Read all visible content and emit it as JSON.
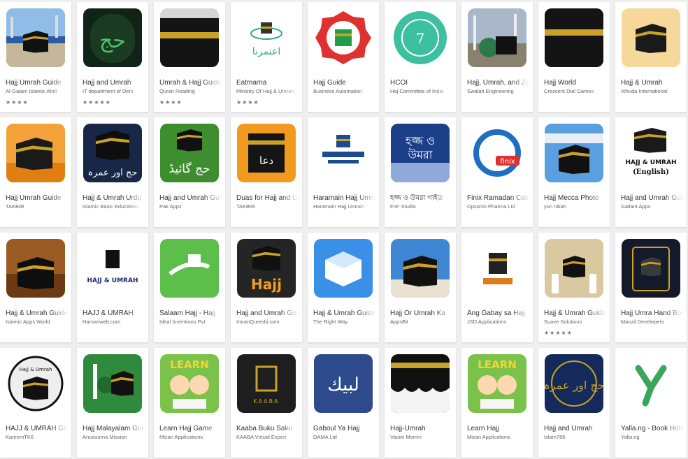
{
  "apps": [
    {
      "title": "Hajj Umrah Guide",
      "developer": "Al-Galam Islamic Ahdi",
      "stars": "★★★★",
      "icon": "kaaba-photo-icon",
      "colors": [
        "#5b8fd0",
        "#1d2a3a"
      ]
    },
    {
      "title": "Hajj and Umrah",
      "developer": "IT department of Deni",
      "stars": "★★★★★",
      "icon": "hajj-umrah-calligraphy-icon",
      "colors": [
        "#0d1f14",
        "#3fae5a"
      ]
    },
    {
      "title": "Umrah & Hajj Guide",
      "developer": "Quran Reading",
      "stars": "★★★★",
      "icon": "kaaba-icon",
      "colors": [
        "#c9c9c9",
        "#1a1a1a"
      ]
    },
    {
      "title": "Eatmarna",
      "developer": "Ministry Of Hajj & Umrah",
      "stars": "★★★★",
      "icon": "eatmarna-logo-icon",
      "colors": [
        "#ffffff",
        "#2aa88a"
      ]
    },
    {
      "title": "Hajj Guide",
      "developer": "Business Automation",
      "stars": "",
      "icon": "kaaba-badge-icon",
      "colors": [
        "#e03131",
        "#1e9e4a"
      ]
    },
    {
      "title": "HCOI",
      "developer": "Haj Committee of India",
      "stars": "",
      "icon": "hcoi-seal-icon",
      "colors": [
        "#3cc0a0",
        "#ffffff"
      ]
    },
    {
      "title": "Hajj, Umrah, and Ziyarat",
      "developer": "Swalah Engineering",
      "stars": "",
      "icon": "mosque-photo-icon",
      "colors": [
        "#8aa3b8",
        "#2c7a4b"
      ]
    },
    {
      "title": "Hajj World",
      "developer": "Crescent Dial Games",
      "stars": "",
      "icon": "kaaba-closeup-icon",
      "colors": [
        "#111111",
        "#c9a227"
      ]
    },
    {
      "title": "Hajj & Umrah",
      "developer": "Alhuda International",
      "stars": "",
      "icon": "kaaba-sunset-icon",
      "colors": [
        "#f3c77a",
        "#1a1a1a"
      ]
    },
    {
      "title": "Hajj Umrah Guide",
      "developer": "TAKBIR",
      "stars": "",
      "icon": "kaaba-orange-icon",
      "colors": [
        "#f09a2b",
        "#1a1a1a"
      ]
    },
    {
      "title": "Hajj & Umrah Urdu",
      "developer": "Islamic Basic Education",
      "stars": "",
      "icon": "kaaba-urdu-icon",
      "colors": [
        "#1a2a4a",
        "#c9a227"
      ]
    },
    {
      "title": "Hajj and Umrah Guide",
      "developer": "Pak Appz",
      "stars": "",
      "icon": "hajj-guide-urdu-icon",
      "colors": [
        "#3e8d2f",
        "#1a1a1a"
      ]
    },
    {
      "title": "Duas for Hajj and Umrah",
      "developer": "TAKBIR",
      "stars": "",
      "icon": "dua-kaaba-icon",
      "colors": [
        "#f29a1f",
        "#1a1a1a"
      ]
    },
    {
      "title": "Haramain Hajj Umrah",
      "developer": "Haramain Hajj Umrah",
      "stars": "",
      "icon": "haramain-logo-icon",
      "colors": [
        "#ffffff",
        "#1c4b8f"
      ]
    },
    {
      "title": "হজ্জ ও উমরা গাইড",
      "developer": "FnF Studio",
      "stars": "",
      "icon": "bengali-hajj-icon",
      "colors": [
        "#1c3f8a",
        "#ffffff"
      ]
    },
    {
      "title": "Finix Ramadan Calendar",
      "developer": "Opsonin Pharma Ltd",
      "stars": "",
      "icon": "finix-logo-icon",
      "colors": [
        "#ffffff",
        "#1e6fc4"
      ]
    },
    {
      "title": "Hajj Mecca Photo",
      "developer": "yun nikah",
      "stars": "",
      "icon": "kaaba-sky-icon",
      "colors": [
        "#5aa0e0",
        "#1a1a1a"
      ]
    },
    {
      "title": "Hajj and Umrah Guide",
      "developer": "Gallant Apps",
      "stars": "",
      "icon": "hajj-umrah-english-icon",
      "colors": [
        "#ffffff",
        "#1a1a1a"
      ]
    },
    {
      "title": "Hajj & Umrah Guide",
      "developer": "Islamic Apps World",
      "stars": "",
      "icon": "kaaba-night-icon",
      "colors": [
        "#6b3a12",
        "#1a1a1a"
      ]
    },
    {
      "title": "HAJJ & UMRAH",
      "developer": "Hamariweb.com",
      "stars": "",
      "icon": "hajj-umrah-text-icon",
      "colors": [
        "#ffffff",
        "#1a2a6c"
      ]
    },
    {
      "title": "Salaam Hajj - Hajj",
      "developer": "Ideal Inventions Pvt",
      "stars": "",
      "icon": "salaam-hajj-icon",
      "colors": [
        "#5bbf4a",
        "#ffffff"
      ]
    },
    {
      "title": "Hajj and Umrah Guide",
      "developer": "ImranQureshi.com",
      "stars": "",
      "icon": "hajj-word-icon",
      "colors": [
        "#2a2a2a",
        "#f0a020"
      ]
    },
    {
      "title": "Hajj & Umrah Guide",
      "developer": "The Right Way",
      "stars": "",
      "icon": "cube-icon",
      "colors": [
        "#3a8fe6",
        "#ffffff"
      ]
    },
    {
      "title": "Hajj Or Umrah Ka",
      "developer": "AppsBit",
      "stars": "",
      "icon": "kaaba-blue-sky-icon",
      "colors": [
        "#3f86d4",
        "#1a1a1a"
      ]
    },
    {
      "title": "Ang Gabay sa Hajj",
      "developer": "JSD Applications",
      "stars": "",
      "icon": "gabay-logo-icon",
      "colors": [
        "#ffffff",
        "#e07a1f"
      ]
    },
    {
      "title": "Hajj & Umrah Guide",
      "developer": "Suave Solutions",
      "stars": "★★★★★",
      "icon": "pilgrims-icon",
      "colors": [
        "#d9c8a0",
        "#1a1a1a"
      ]
    },
    {
      "title": "Hajj Umra Hand Book",
      "developer": "Manzil Developers",
      "stars": "",
      "icon": "handbook-icon",
      "colors": [
        "#151a2a",
        "#c9a227"
      ]
    },
    {
      "title": "HAJJ & UMRAH Guide",
      "developer": "KareemTK6",
      "stars": "",
      "icon": "hajj-umrah-round-icon",
      "colors": [
        "#ffffff",
        "#1a1a1a"
      ]
    },
    {
      "title": "Hajj Malayalam Guide",
      "developer": "Anusuurna Mission",
      "stars": "",
      "icon": "malayalam-mosque-icon",
      "colors": [
        "#2f8a3e",
        "#1a1a1a"
      ]
    },
    {
      "title": "Learn Hajj Game",
      "developer": "Mizan Applications",
      "stars": "",
      "icon": "learn-hajj-kids-icon",
      "colors": [
        "#7bc24a",
        "#f2d43a"
      ]
    },
    {
      "title": "Kaaba Buku Saku",
      "developer": "KAABA Virtual Expert",
      "stars": "",
      "icon": "kaaba-logo-icon",
      "colors": [
        "#1e1e1e",
        "#c9a227"
      ]
    },
    {
      "title": "Gaboul Ya Hajj",
      "developer": "DAMA Ltd",
      "stars": "",
      "icon": "gaboul-calligraphy-icon",
      "colors": [
        "#2d4a8c",
        "#ffffff"
      ]
    },
    {
      "title": "Hajj-Umrah",
      "developer": "Vasim Momin",
      "stars": "",
      "icon": "kaaba-arches-icon",
      "colors": [
        "#111111",
        "#c9a227"
      ]
    },
    {
      "title": "Learn Hajj",
      "developer": "Mizan Applications",
      "stars": "",
      "icon": "learn-hajj-kids-icon",
      "colors": [
        "#7bc24a",
        "#f2d43a"
      ]
    },
    {
      "title": "Hajj and Umrah",
      "developer": "Islam786",
      "stars": "",
      "icon": "urdu-calligraphy-icon",
      "colors": [
        "#132a5a",
        "#c9a227"
      ]
    },
    {
      "title": "Yalla.ng - Book Hotel",
      "developer": "Yalla.ng",
      "stars": "",
      "icon": "yalla-logo-icon",
      "colors": [
        "#ffffff",
        "#3aa65a"
      ]
    }
  ]
}
